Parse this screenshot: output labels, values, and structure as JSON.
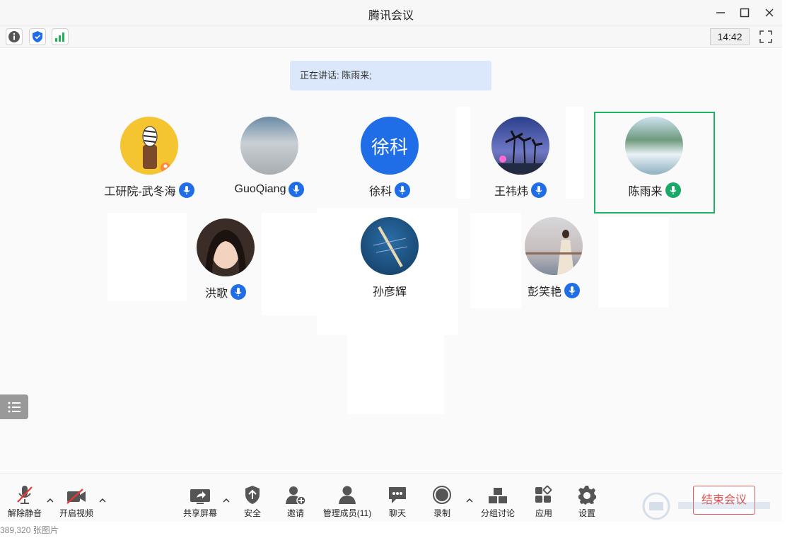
{
  "window": {
    "title": "腾讯会议"
  },
  "infobar": {
    "clock": "14:42",
    "icons": [
      "info-icon",
      "shield-icon",
      "signal-icon"
    ]
  },
  "speaking": {
    "text": "正在讲话: 陈雨来;"
  },
  "participants": [
    {
      "name": "工研院-武冬海",
      "mic": "on",
      "avatar": "zebra-cartoon"
    },
    {
      "name": "GuoQiang",
      "mic": "on",
      "avatar": "clouds-photo"
    },
    {
      "name": "徐科",
      "mic": "on",
      "avatar_text": "徐科"
    },
    {
      "name": "王祎炜",
      "mic": "on",
      "avatar": "palm-trees-photo"
    },
    {
      "name": "陈雨来",
      "mic": "speaking",
      "avatar": "waterfall-photo"
    },
    {
      "name": "洪歌",
      "mic": "on",
      "avatar": "woman-portrait"
    },
    {
      "name": "孙彦辉",
      "mic": "none",
      "avatar": "rowing-photo"
    },
    {
      "name": "彭笑艳",
      "mic": "on",
      "avatar": "woman-seaside"
    }
  ],
  "toolbar": {
    "unmute": "解除静音",
    "video": "开启视频",
    "share": "共享屏幕",
    "security": "安全",
    "invite": "邀请",
    "members": "管理成员(11)",
    "chat": "聊天",
    "record": "录制",
    "breakout": "分组讨论",
    "apps": "应用",
    "settings": "设置",
    "end": "结束会议"
  },
  "footer": {
    "text": "389,320 张图片"
  },
  "colors": {
    "accent_blue": "#1f6ee8",
    "active_green": "#1cb564",
    "end_red": "#e14b4b"
  }
}
